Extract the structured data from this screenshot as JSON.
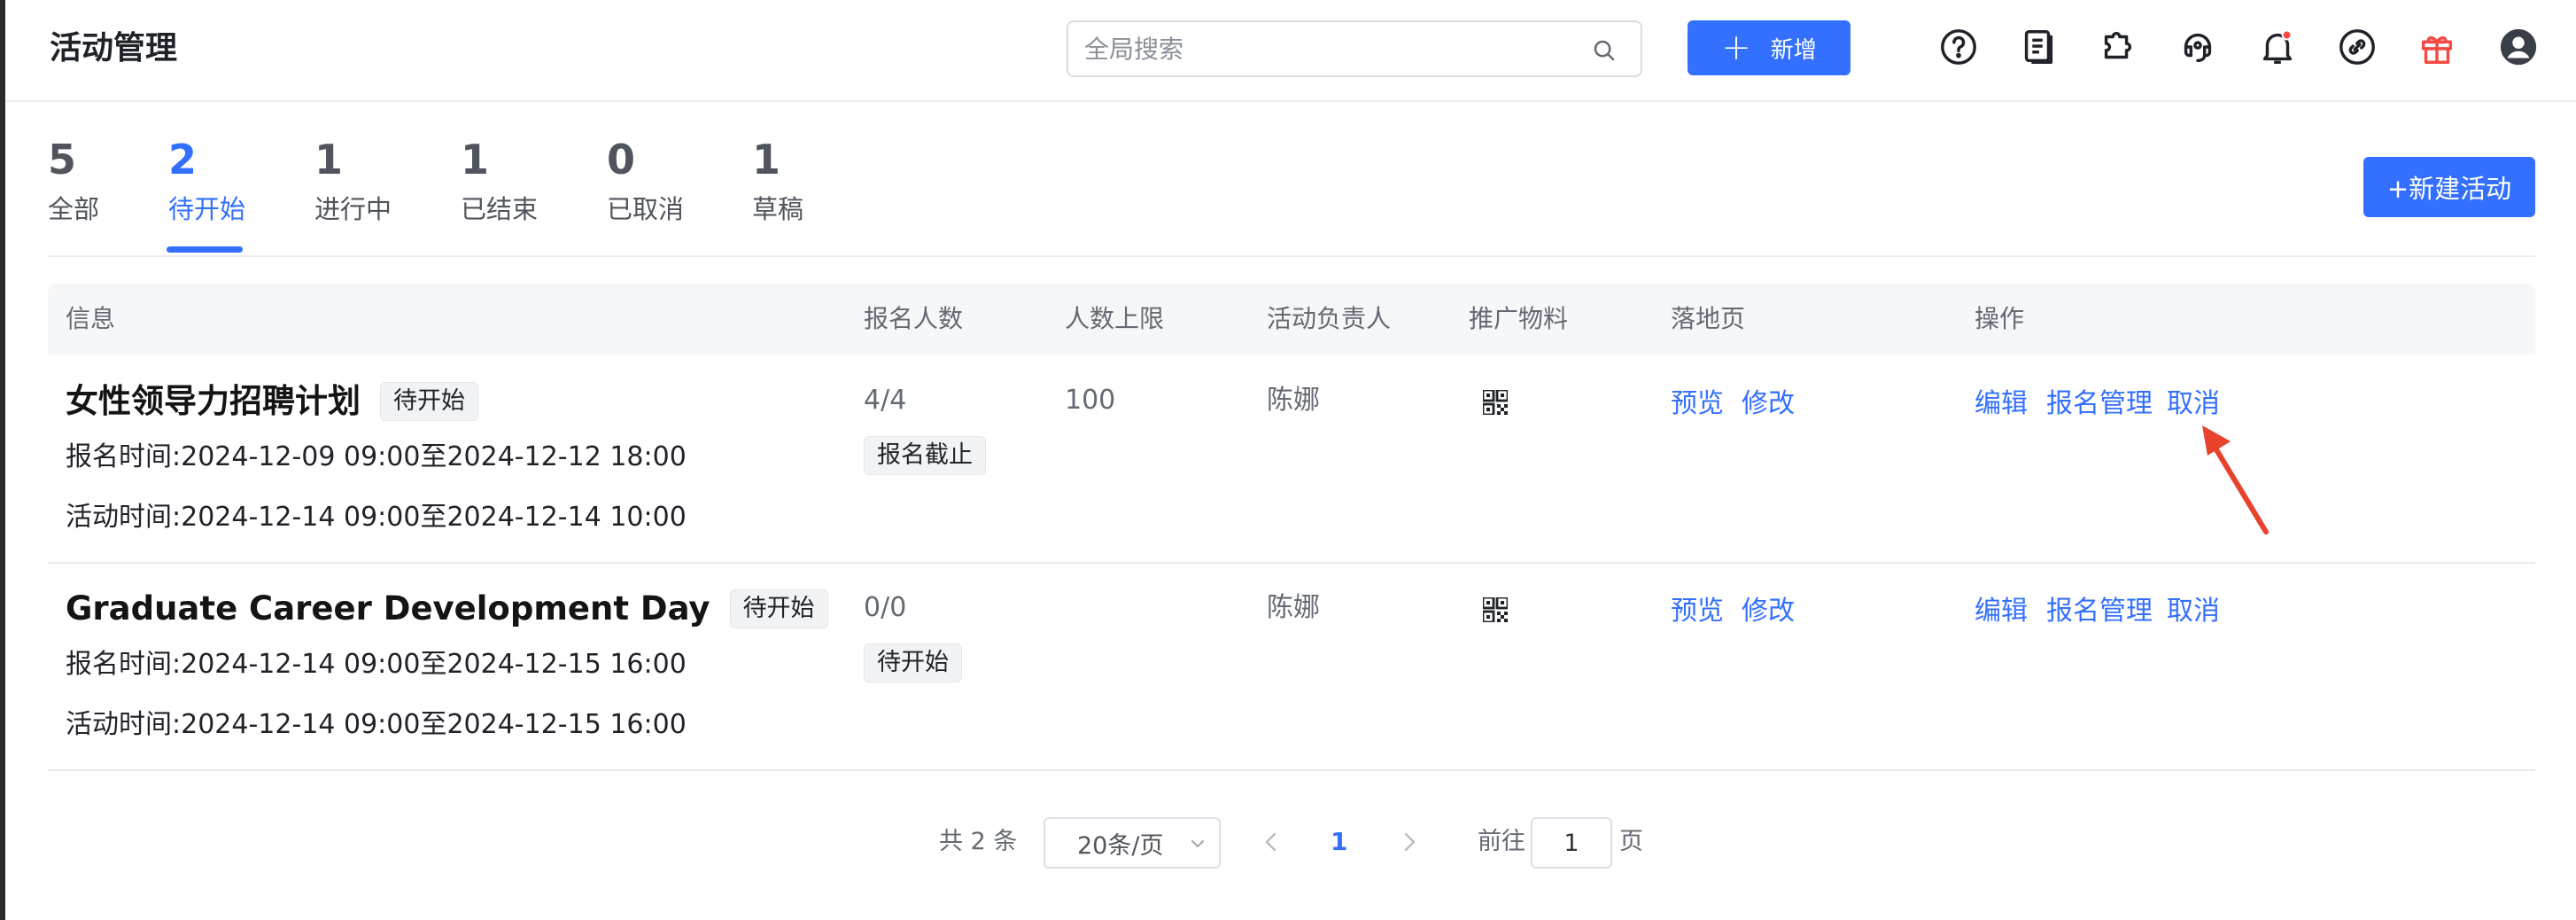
{
  "header": {
    "title": "活动管理",
    "search_placeholder": "全局搜索",
    "add_label": "新增",
    "icons": [
      "help-icon",
      "document-icon",
      "plugin-icon",
      "headset-icon",
      "bell-icon",
      "link-icon",
      "gift-icon",
      "user-icon"
    ],
    "notification_dot_color": "#f54a45",
    "gift_icon_color": "#f54a45"
  },
  "tabs": [
    {
      "count": "5",
      "label": "全部"
    },
    {
      "count": "2",
      "label": "待开始",
      "active": true
    },
    {
      "count": "1",
      "label": "进行中"
    },
    {
      "count": "1",
      "label": "已结束"
    },
    {
      "count": "0",
      "label": "已取消"
    },
    {
      "count": "1",
      "label": "草稿"
    }
  ],
  "new_activity_label": "+新建活动",
  "table": {
    "columns": [
      "信息",
      "报名人数",
      "人数上限",
      "活动负责人",
      "推广物料",
      "落地页",
      "操作"
    ],
    "rows": [
      {
        "title": "女性领导力招聘计划",
        "status": "待开始",
        "signup_time": "报名时间:2024-12-09 09:00至2024-12-12 18:00",
        "activity_time": "活动时间:2024-12-14 09:00至2024-12-14 10:00",
        "signups": "4/4",
        "signup_status": "报名截止",
        "limit": "100",
        "owner": "陈娜",
        "landing": [
          "预览",
          "修改"
        ],
        "actions": [
          "编辑",
          "报名管理",
          "取消"
        ]
      },
      {
        "title": "Graduate Career Development Day",
        "status": "待开始",
        "signup_time": "报名时间:2024-12-14 09:00至2024-12-15 16:00",
        "activity_time": "活动时间:2024-12-14 09:00至2024-12-15 16:00",
        "signups": "0/0",
        "signup_status": "待开始",
        "limit": "",
        "owner": "陈娜",
        "landing": [
          "预览",
          "修改"
        ],
        "actions": [
          "编辑",
          "报名管理",
          "取消"
        ]
      }
    ]
  },
  "pagination": {
    "total": "共 2 条",
    "page_size": "20条/页",
    "current_page": "1",
    "goto_label": "前往",
    "goto_value": "1",
    "page_unit": "页"
  },
  "colors": {
    "accent": "#3370ff",
    "annotation_arrow": "#e8412c"
  }
}
